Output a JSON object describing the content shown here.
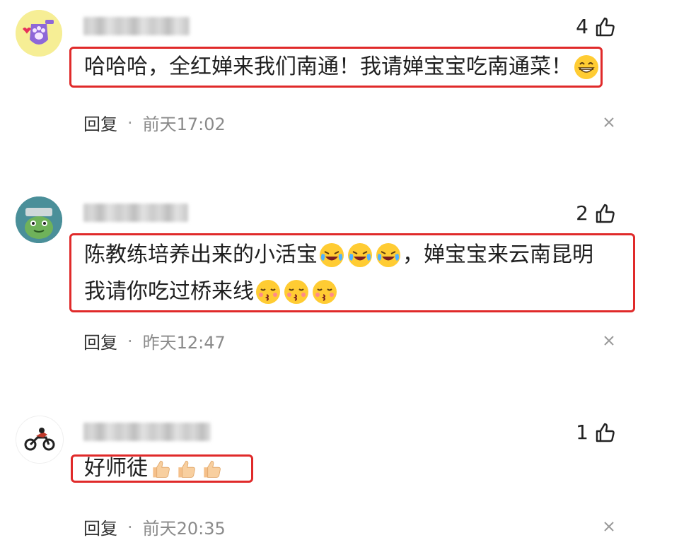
{
  "comments": [
    {
      "likes": "4",
      "text_parts": [
        "哈哈哈，全红婵来我们南通！我请婵宝宝吃南通菜！"
      ],
      "reply_label": "回复",
      "separator": "·",
      "time": "前天17:02",
      "emoji": "grinning-emoji"
    },
    {
      "likes": "2",
      "line1_a": "陈教练培养出来的小活宝",
      "line1_b": "，婵宝宝来云南昆明",
      "line2": "我请你吃过桥来线",
      "reply_label": "回复",
      "separator": "·",
      "time": "昨天12:47",
      "emoji1": "laughing-crying-emoji",
      "emoji2": "kissing-emoji"
    },
    {
      "likes": "1",
      "text": "好师徒",
      "reply_label": "回复",
      "separator": "·",
      "time": "前天20:35",
      "emoji": "thumbs-up-emoji"
    }
  ],
  "colors": {
    "highlight_border": "#e02a2a",
    "meta_text": "#8a8a8a"
  }
}
